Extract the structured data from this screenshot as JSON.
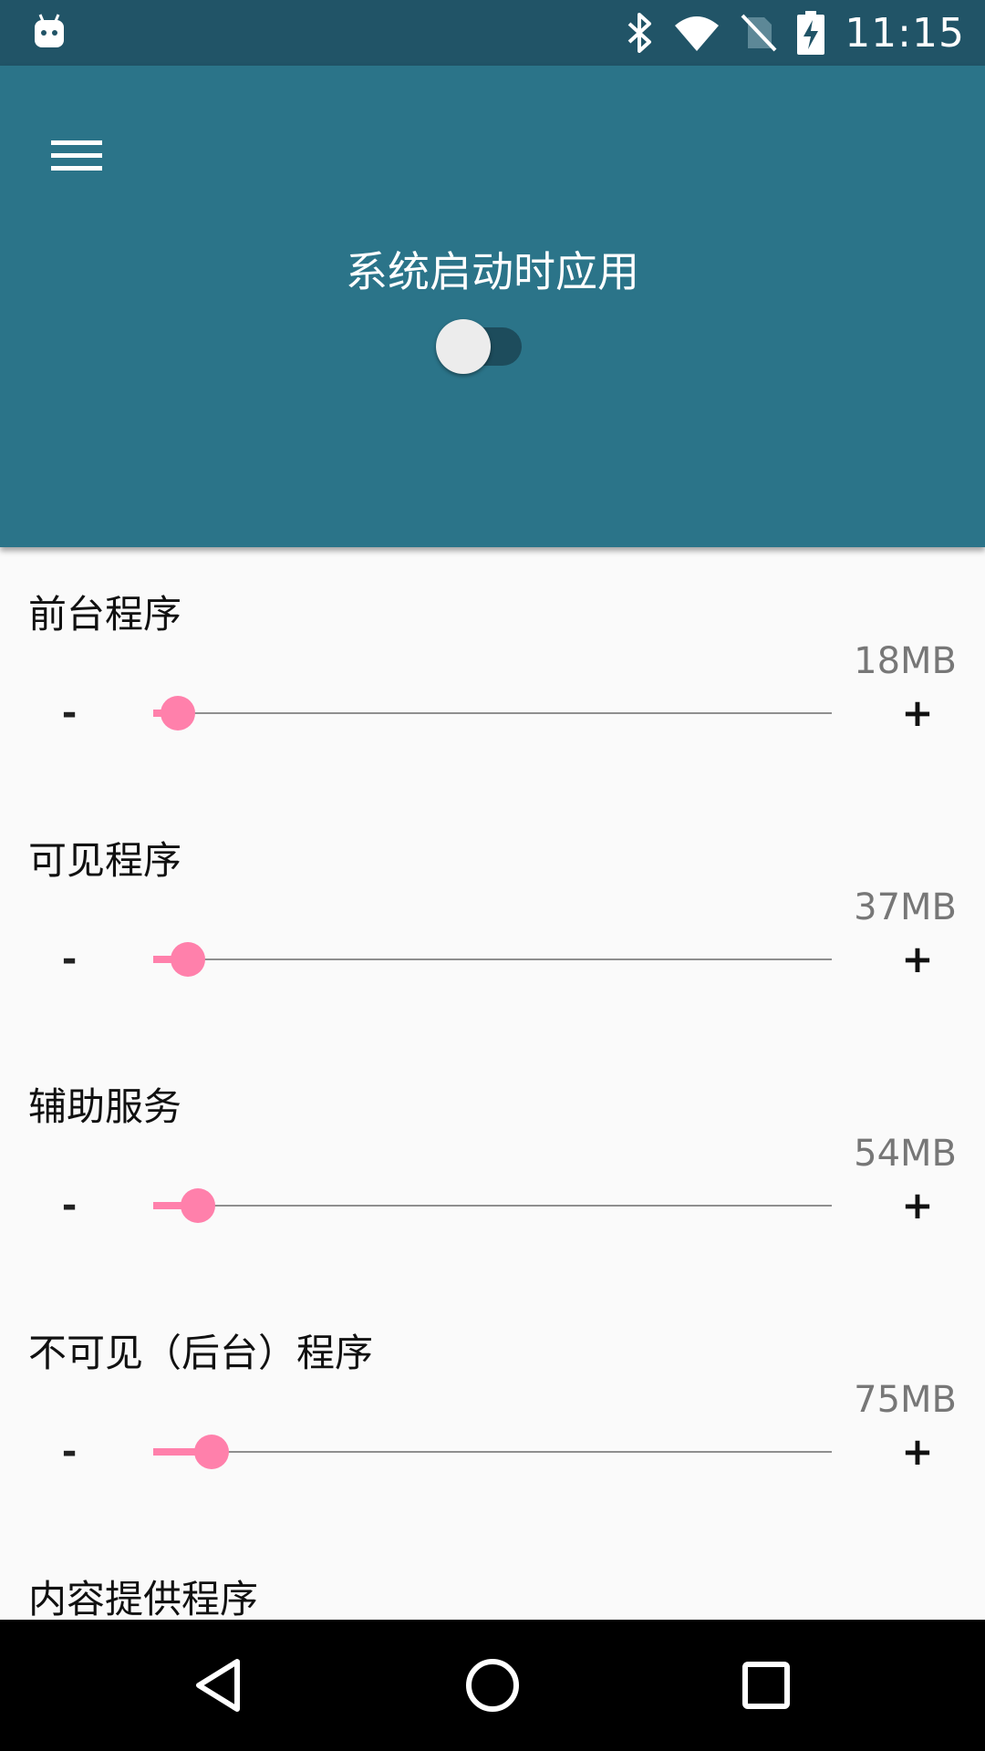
{
  "status_bar": {
    "time": "11:15",
    "icons": [
      "android-notification-icon",
      "bluetooth-icon",
      "wifi-icon",
      "no-sim-icon",
      "battery-charging-icon"
    ]
  },
  "header": {
    "menu_icon": "menu-icon",
    "boot_label": "系统启动时应用",
    "boot_switch_on": false
  },
  "sections": [
    {
      "title": "前台程序",
      "value": "18MB",
      "minus": "-",
      "plus": "+",
      "level": 0.02
    },
    {
      "title": "可见程序",
      "value": "37MB",
      "minus": "-",
      "plus": "+",
      "level": 0.035
    },
    {
      "title": "辅助服务",
      "value": "54MB",
      "minus": "-",
      "plus": "+",
      "level": 0.05
    },
    {
      "title": "不可见（后台）程序",
      "value": "75MB",
      "minus": "-",
      "plus": "+",
      "level": 0.07
    },
    {
      "title": "内容提供程序"
    }
  ],
  "nav_bar": {
    "icons": [
      "back-icon",
      "home-icon",
      "recents-icon"
    ]
  },
  "colors": {
    "status_bar": "#215467",
    "app_bar": "#2b7489",
    "accent": "#ff80ab",
    "background": "#fafafa"
  }
}
